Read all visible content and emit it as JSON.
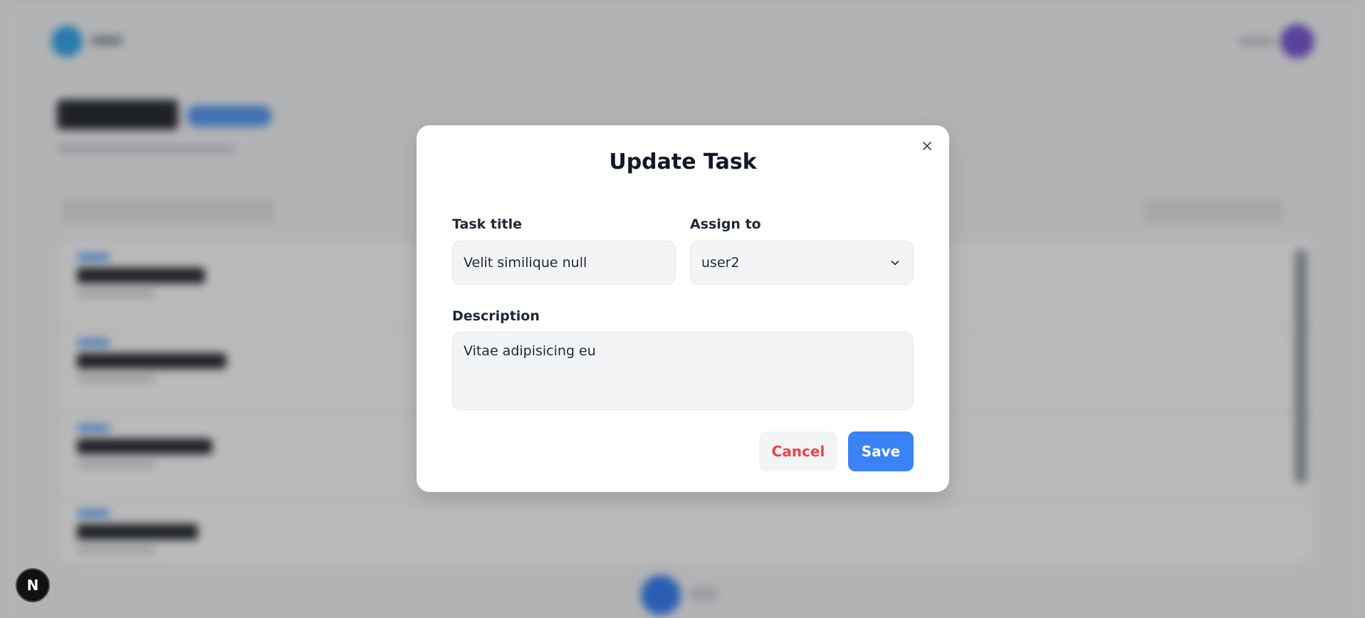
{
  "modal": {
    "title": "Update Task",
    "task_title_label": "Task title",
    "task_title_value": "Velit similique null",
    "assign_label": "Assign to",
    "assign_value": "user2",
    "description_label": "Description",
    "description_value": "Vitae adipisicing eu",
    "cancel_label": "Cancel",
    "save_label": "Save"
  },
  "dev_badge": {
    "letter": "N"
  },
  "colors": {
    "primary": "#3b82f6",
    "danger": "#ef4444",
    "input_bg": "#f3f4f6"
  },
  "icons": {
    "close": "close-icon",
    "dropdown": "chevron-down-icon"
  }
}
